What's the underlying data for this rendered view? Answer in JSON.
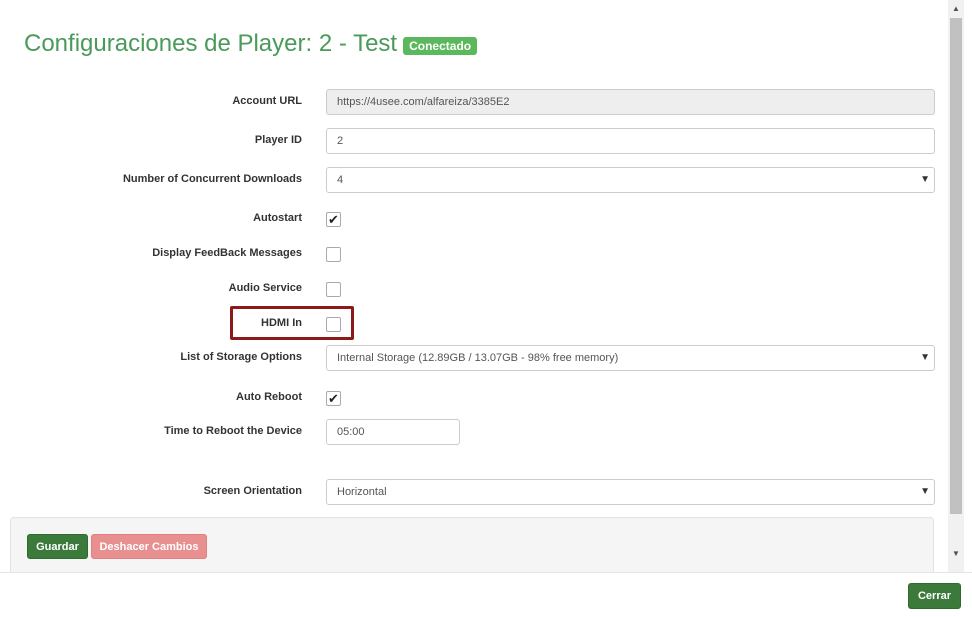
{
  "header": {
    "title": "Configuraciones de Player: 2 - Test",
    "status_badge": "Conectado"
  },
  "form": {
    "account_url": {
      "label": "Account URL",
      "value": "https://4usee.com/alfareiza/3385E2"
    },
    "player_id": {
      "label": "Player ID",
      "value": "2"
    },
    "concurrent_downloads": {
      "label": "Number of Concurrent Downloads",
      "value": "4"
    },
    "autostart": {
      "label": "Autostart",
      "checked": true,
      "mark": "✔"
    },
    "feedback_messages": {
      "label": "Display FeedBack Messages",
      "checked": false
    },
    "audio_service": {
      "label": "Audio Service",
      "checked": false
    },
    "hdmi_in": {
      "label": "HDMI In",
      "checked": false
    },
    "storage_options": {
      "label": "List of Storage Options",
      "value": "Internal Storage (12.89GB / 13.07GB - 98% free memory)"
    },
    "auto_reboot": {
      "label": "Auto Reboot",
      "checked": true,
      "mark": "✔"
    },
    "reboot_time": {
      "label": "Time to Reboot the Device",
      "value": "05:00"
    },
    "screen_orientation": {
      "label": "Screen Orientation",
      "value": "Horizontal"
    }
  },
  "actions": {
    "save_label": "Guardar",
    "undo_label": "Deshacer Cambios"
  },
  "footer": {
    "close_label": "Cerrar"
  },
  "colors": {
    "title": "#4a9a5a",
    "badge": "#5cb85c",
    "primary_button": "#3c7a3c",
    "undo_button": "#e89090",
    "highlight_border": "#8b1a1a"
  },
  "icons": {
    "select_arrow": "caret-down-icon",
    "checkmark": "checkmark-icon"
  }
}
